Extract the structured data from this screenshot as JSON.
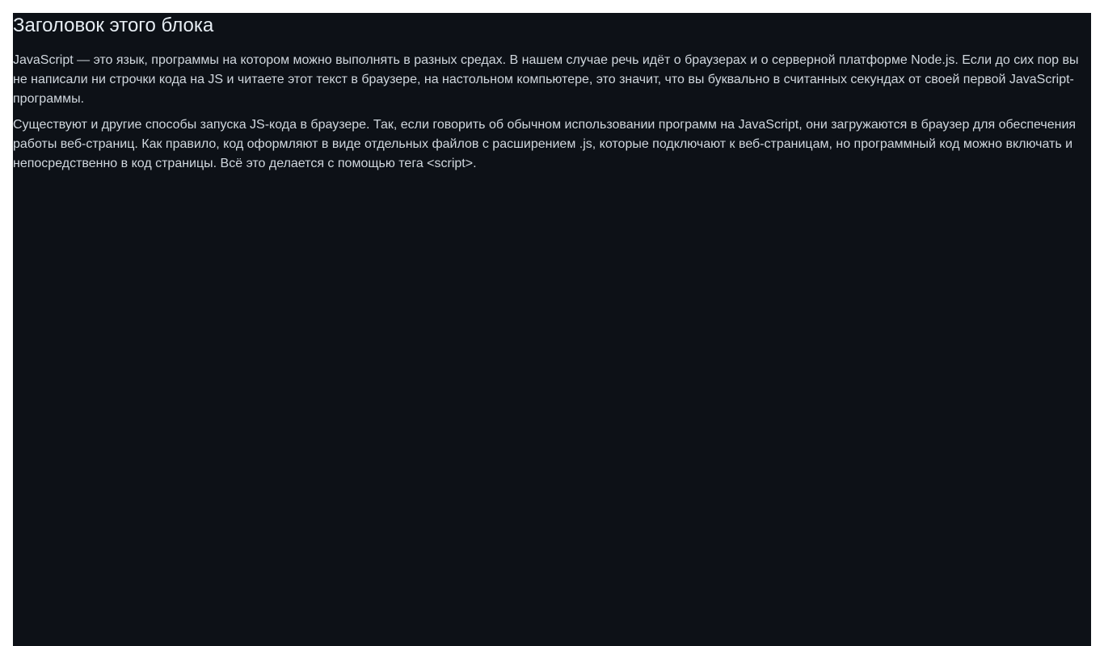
{
  "block": {
    "title": "Заголовок этого блока",
    "paragraphs": [
      "JavaScript — это язык, программы на котором можно выполнять в разных средах. В нашем случае речь идёт о браузерах и о серверной платформе Node.js. Если до сих пор вы не написали ни строчки кода на JS и читаете этот текст в браузере, на настольном компьютере, это значит, что вы буквально в считанных секундах от своей первой JavaScript-программы.",
      "Существуют и другие способы запуска JS-кода в браузере. Так, если говорить об обычном использовании программ на JavaScript, они загружаются в браузер для обеспечения работы веб-страниц. Как правило, код оформляют в виде отдельных файлов с расширением .js, которые подключают к веб-страницам, но программный код можно включать и непосредственно в код страницы. Всё это делается с помощью тега <script>."
    ]
  },
  "colors": {
    "background": "#0d1117",
    "text": "#e6edf3"
  }
}
